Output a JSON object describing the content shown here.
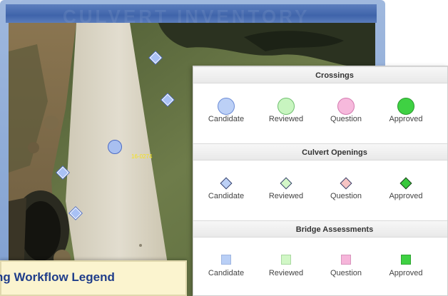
{
  "window": {
    "banner_title": "CULVERT INVENTORY"
  },
  "map": {
    "feature_label": "16-0274",
    "road_color": "#d9d5c6",
    "shoulder_color": "#9b8461",
    "vegetation_color": "#5c6b3e",
    "marker_fill": "#a9c1f5",
    "marker_stroke": "#4c6bc4"
  },
  "legend": {
    "sections": [
      {
        "title": "Crossings",
        "symbol": "circle-icon",
        "items": [
          {
            "label": "Candidate",
            "fill": "#bcd0f6",
            "stroke": "#6b8bd6"
          },
          {
            "label": "Reviewed",
            "fill": "#c8f5c0",
            "stroke": "#6fbf6f"
          },
          {
            "label": "Question",
            "fill": "#f6b9dc",
            "stroke": "#d47ab0"
          },
          {
            "label": "Approved",
            "fill": "#3fd143",
            "stroke": "#2a9a2d"
          }
        ]
      },
      {
        "title": "Culvert Openings",
        "symbol": "diamond-icon",
        "items": [
          {
            "label": "Candidate",
            "fill": "#bcd0f6",
            "stroke": "#35406b"
          },
          {
            "label": "Reviewed",
            "fill": "#d3f7c8",
            "stroke": "#35406b"
          },
          {
            "label": "Question",
            "fill": "#f7c4c4",
            "stroke": "#35406b"
          },
          {
            "label": "Approved",
            "fill": "#37c83b",
            "stroke": "#1f3d1f"
          }
        ]
      },
      {
        "title": "Bridge Assessments",
        "symbol": "square-icon",
        "items": [
          {
            "label": "Candidate",
            "fill": "#b9cff6",
            "stroke": "#9fb5e0"
          },
          {
            "label": "Reviewed",
            "fill": "#d1f7c6",
            "stroke": "#a9d8a0"
          },
          {
            "label": "Question",
            "fill": "#f6b5da",
            "stroke": "#d895bd"
          },
          {
            "label": "Approved",
            "fill": "#3fd143",
            "stroke": "#2fa632"
          }
        ]
      }
    ]
  },
  "caption": {
    "text": "ng Workflow Legend"
  }
}
